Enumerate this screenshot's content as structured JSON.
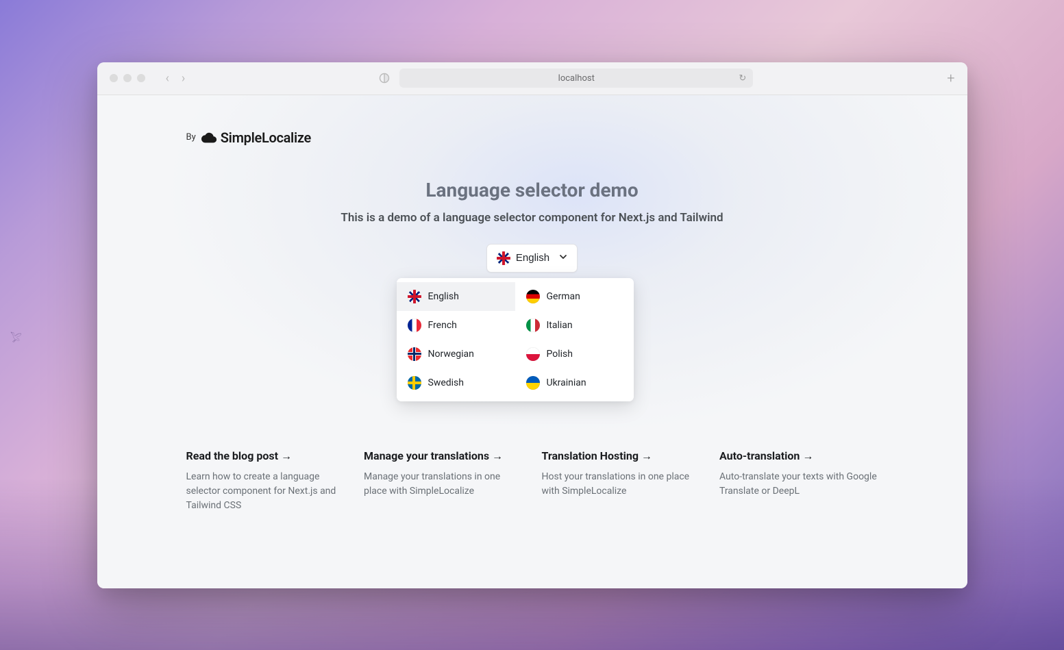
{
  "browser": {
    "url": "localhost"
  },
  "header": {
    "by": "By",
    "brand": "SimpleLocalize"
  },
  "hero": {
    "title": "Language selector demo",
    "subtitle": "This is a demo of a language selector component for Next.js and Tailwind"
  },
  "selector": {
    "selected_label": "English",
    "options": [
      {
        "label": "English",
        "flag": "uk",
        "selected": true
      },
      {
        "label": "German",
        "flag": "de",
        "selected": false
      },
      {
        "label": "French",
        "flag": "fr",
        "selected": false
      },
      {
        "label": "Italian",
        "flag": "it",
        "selected": false
      },
      {
        "label": "Norwegian",
        "flag": "no",
        "selected": false
      },
      {
        "label": "Polish",
        "flag": "pl",
        "selected": false
      },
      {
        "label": "Swedish",
        "flag": "se",
        "selected": false
      },
      {
        "label": "Ukrainian",
        "flag": "ua",
        "selected": false
      }
    ]
  },
  "cards": [
    {
      "title": "Read the blog post →",
      "desc": "Learn how to create a language selector component for Next.js and Tailwind CSS"
    },
    {
      "title": "Manage your translations →",
      "desc": "Manage your translations in one place with SimpleLocalize"
    },
    {
      "title": "Translation Hosting →",
      "desc": "Host your translations in one place with SimpleLocalize"
    },
    {
      "title": "Auto-translation →",
      "desc": "Auto-translate your texts with Google Translate or DeepL"
    }
  ]
}
